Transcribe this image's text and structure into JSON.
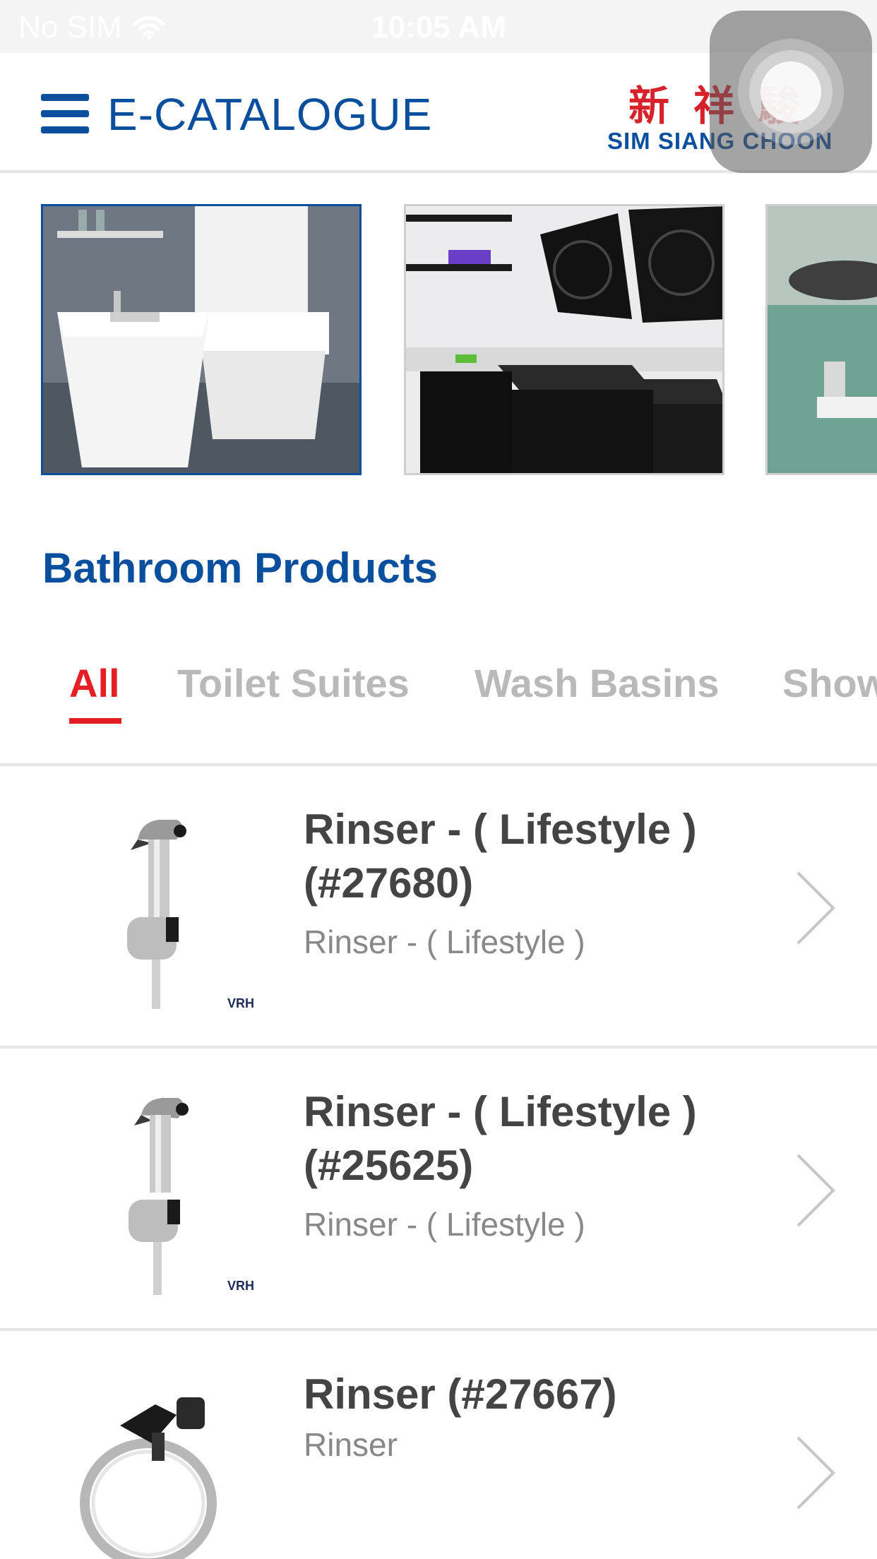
{
  "status_bar": {
    "carrier": "No SIM",
    "time": "10:05 AM"
  },
  "header": {
    "title": "E-CATALOGUE",
    "logo_cjk": "新祥駿",
    "logo_en": "SIM SIANG CHOON"
  },
  "categories": [
    {
      "name": "bathroom",
      "selected": true
    },
    {
      "name": "kitchen",
      "selected": false
    },
    {
      "name": "sink",
      "selected": false
    }
  ],
  "section_title": "Bathroom Products",
  "tabs": [
    {
      "label": "All",
      "active": true
    },
    {
      "label": "Toilet Suites",
      "active": false
    },
    {
      "label": "Wash Basins",
      "active": false
    },
    {
      "label": "Show",
      "active": false
    }
  ],
  "products": [
    {
      "name": "Rinser - ( Lifestyle ) (#27680)",
      "subtitle": "Rinser - ( Lifestyle )",
      "brand": "VRH"
    },
    {
      "name": "Rinser - ( Lifestyle ) (#25625)",
      "subtitle": "Rinser - ( Lifestyle )",
      "brand": "VRH"
    },
    {
      "name": "Rinser (#27667)",
      "subtitle": "Rinser",
      "brand": ""
    }
  ],
  "colors": {
    "brand_blue": "#0a4f9e",
    "accent_red": "#e41f26",
    "tab_inactive": "#b9b9b9"
  }
}
